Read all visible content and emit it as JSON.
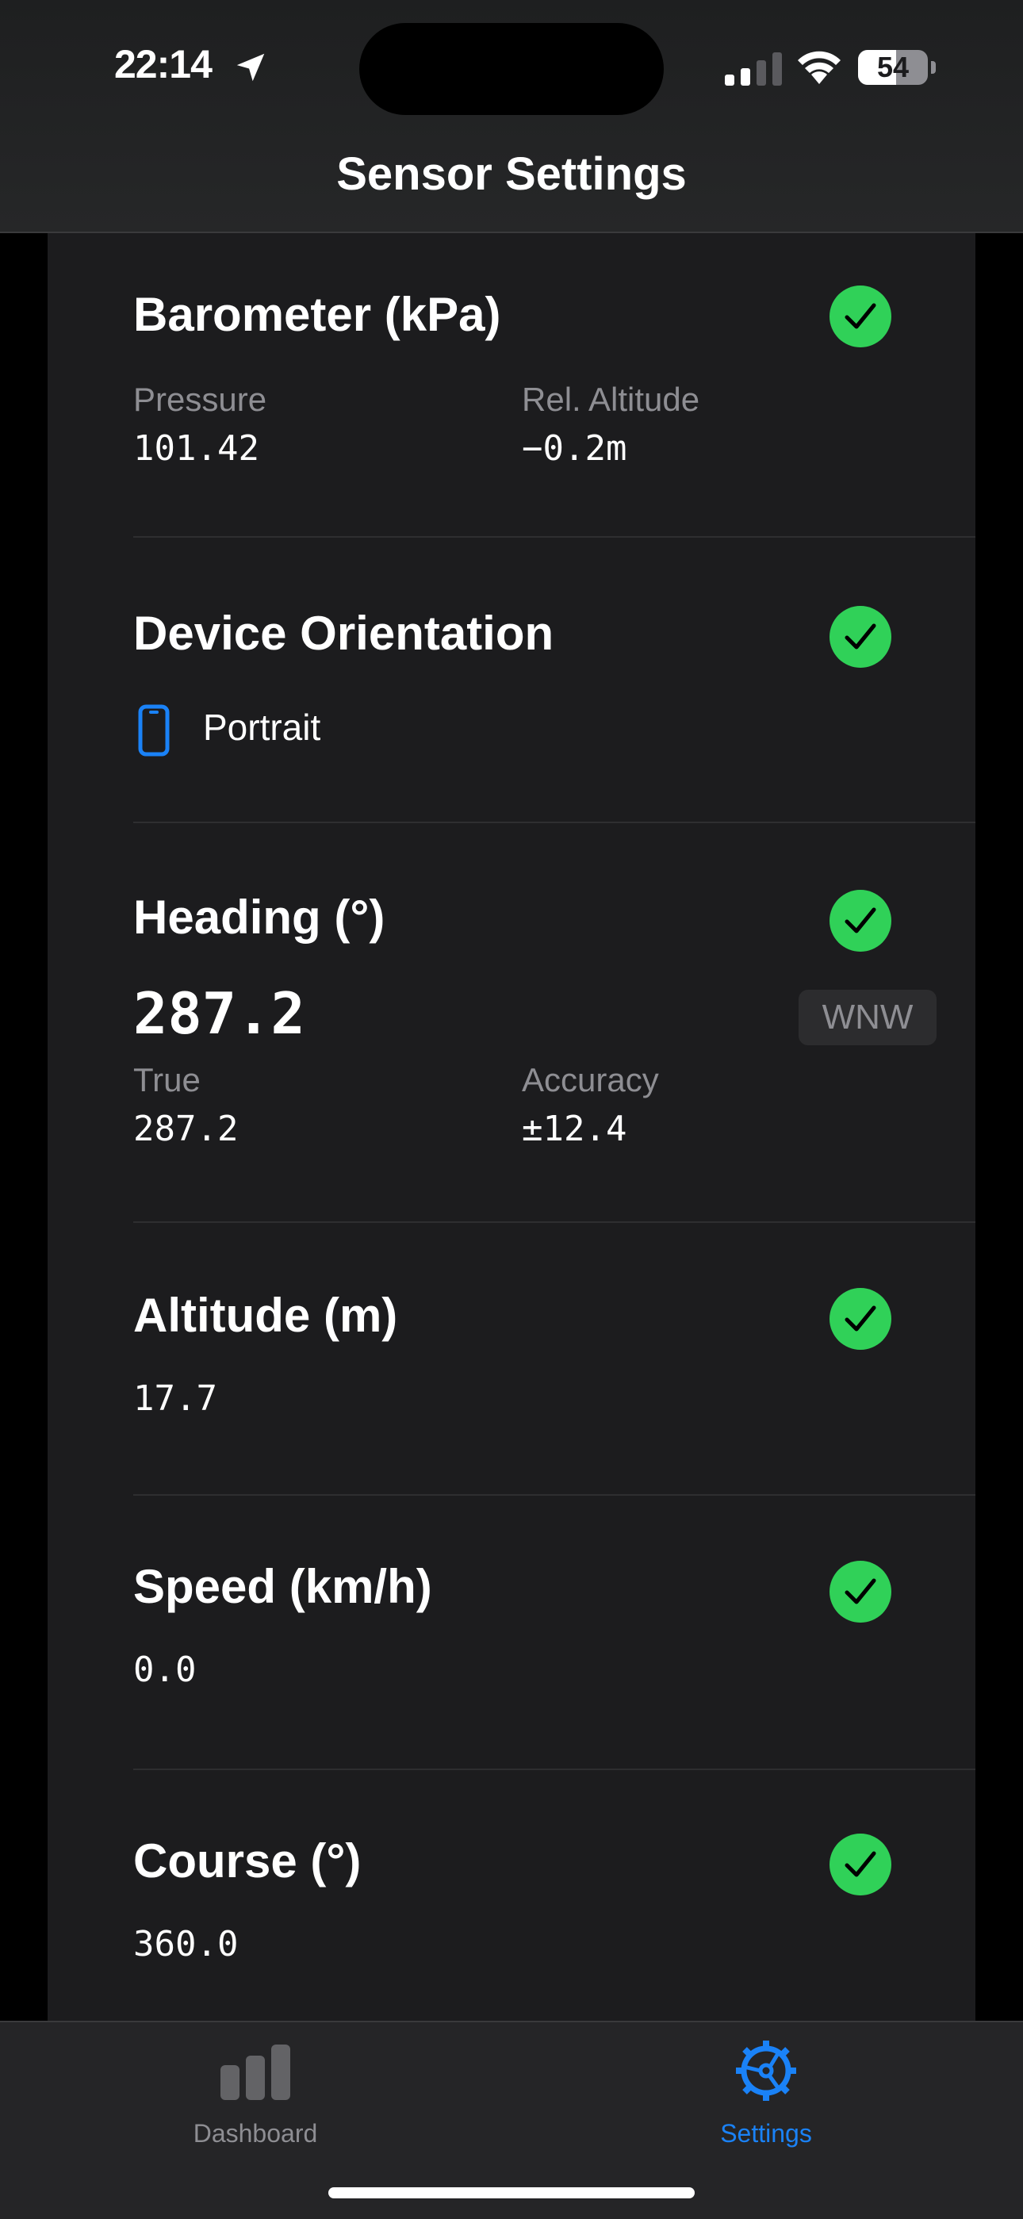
{
  "status_bar": {
    "time": "22:14",
    "battery_percent": "54",
    "icons": [
      "location-arrow-icon",
      "cellular-signal-icon",
      "wifi-icon",
      "battery-icon"
    ]
  },
  "nav": {
    "title": "Sensor Settings"
  },
  "colors": {
    "accent": "#1a82f7",
    "check_green": "#30d158",
    "card_bg": "#1c1c1e",
    "secondary_text": "#8e8e93"
  },
  "sections": {
    "barometer": {
      "title": "Barometer (kPa)",
      "pressure_label": "Pressure",
      "pressure_value": "101.42",
      "rel_alt_label": "Rel. Altitude",
      "rel_alt_value": "−0.2m",
      "status_icon": "checkmark-circle-icon"
    },
    "orientation": {
      "title": "Device Orientation",
      "value": "Portrait",
      "icon": "iphone-portrait-icon",
      "status_icon": "checkmark-circle-icon"
    },
    "heading": {
      "title": "Heading (°)",
      "big_value": "287.2",
      "direction": "WNW",
      "true_label": "True",
      "true_value": "287.2",
      "accuracy_label": "Accuracy",
      "accuracy_value": "±12.4",
      "status_icon": "checkmark-circle-icon"
    },
    "altitude": {
      "title": "Altitude (m)",
      "value": "17.7",
      "status_icon": "checkmark-circle-icon"
    },
    "speed": {
      "title": "Speed (km/h)",
      "value": "0.0",
      "status_icon": "checkmark-circle-icon"
    },
    "course": {
      "title": "Course (°)",
      "value": "360.0",
      "status_icon": "checkmark-circle-icon"
    }
  },
  "tabbar": {
    "dashboard": {
      "label": "Dashboard",
      "icon": "bar-chart-icon",
      "selected": false
    },
    "settings": {
      "label": "Settings",
      "icon": "gear-icon",
      "selected": true
    }
  }
}
